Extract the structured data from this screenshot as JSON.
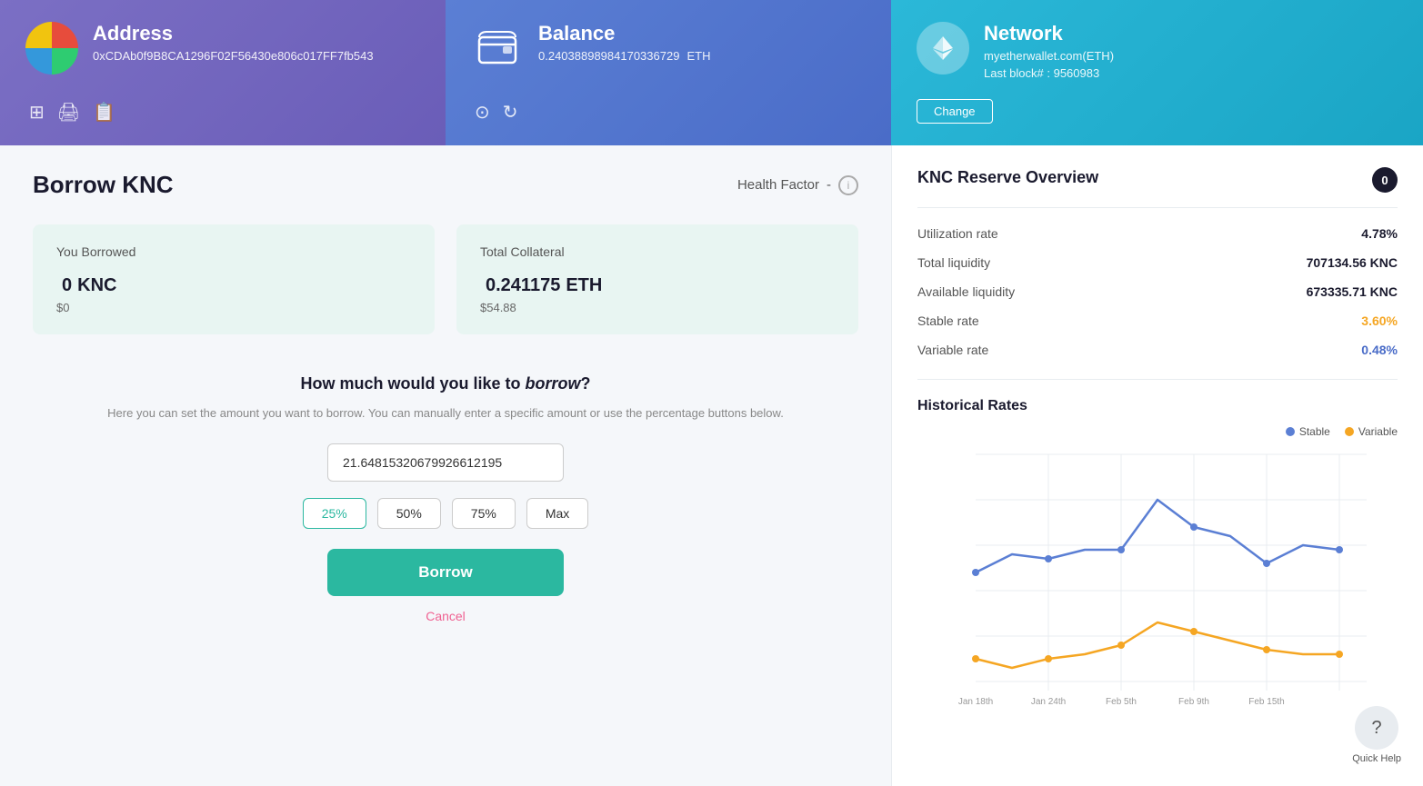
{
  "header": {
    "address": {
      "title": "Address",
      "value": "0xCDAb0f9B8CA1296F02F56430e806c017FF7fb543",
      "icons": [
        "qr-icon",
        "print-icon",
        "copy-icon"
      ]
    },
    "balance": {
      "title": "Balance",
      "value": "0.24038898984170336729",
      "currency": "ETH",
      "icons": [
        "more-icon",
        "refresh-icon"
      ]
    },
    "network": {
      "title": "Network",
      "provider": "myetherwallet.com(ETH)",
      "block": "Last block# : 9560983",
      "change_label": "Change"
    }
  },
  "main": {
    "page_title": "Borrow KNC",
    "health_factor_label": "Health Factor",
    "you_borrowed_label": "You Borrowed",
    "you_borrowed_value": "0",
    "you_borrowed_currency": "KNC",
    "you_borrowed_usd": "$0",
    "total_collateral_label": "Total Collateral",
    "total_collateral_value": "0.241175",
    "total_collateral_currency": "ETH",
    "total_collateral_usd": "$54.88",
    "form": {
      "title_start": "How much would you like to",
      "title_keyword": "borrow",
      "title_end": "?",
      "desc": "Here you can set the amount you want to borrow. You can manually enter a specific amount or use the percentage buttons below.",
      "input_value": "21.64815320679926612195",
      "percent_buttons": [
        "25%",
        "50%",
        "75%",
        "Max"
      ],
      "active_percent": "25%",
      "borrow_btn": "Borrow",
      "cancel_btn": "Cancel"
    }
  },
  "right_panel": {
    "title": "KNC Reserve Overview",
    "stats": [
      {
        "label": "Utilization rate",
        "value": "4.78%",
        "color": "normal"
      },
      {
        "label": "Total liquidity",
        "value": "707134.56 KNC",
        "color": "normal"
      },
      {
        "label": "Available liquidity",
        "value": "673335.71 KNC",
        "color": "normal"
      },
      {
        "label": "Stable rate",
        "value": "3.60%",
        "color": "orange"
      },
      {
        "label": "Variable rate",
        "value": "0.48%",
        "color": "blue"
      }
    ],
    "chart": {
      "title": "Historical Rates",
      "legend": [
        {
          "label": "Stable",
          "color": "#5B7FD4"
        },
        {
          "label": "Variable",
          "color": "#f5a623"
        }
      ],
      "x_labels": [
        "Jan 18th",
        "Jan 24th",
        "Feb 5th",
        "Feb 9th",
        "Feb 15th"
      ],
      "stable_data": [
        3.2,
        3.8,
        3.6,
        3.5,
        5.8,
        5.2,
        4.1,
        3.5
      ],
      "variable_data": [
        0.3,
        0.35,
        0.4,
        0.42,
        0.9,
        0.75,
        0.6,
        0.5
      ]
    }
  },
  "quick_help": {
    "label": "Quick Help"
  }
}
